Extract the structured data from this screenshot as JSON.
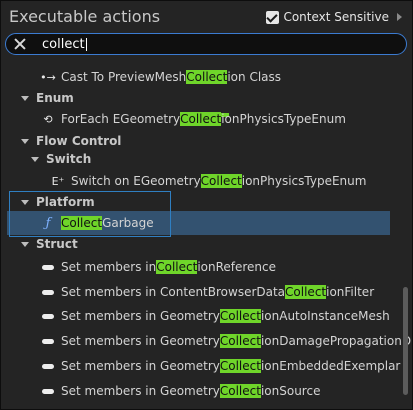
{
  "header": {
    "title": "Executable actions",
    "context_label": "Context Sensitive",
    "context_checked": true
  },
  "search": {
    "value": "collect"
  },
  "items": {
    "cast": {
      "pre": "Cast To PreviewMesh",
      "match": "Collect",
      "post": "ion Class"
    },
    "cat_enum": "Enum",
    "foreach": {
      "pre": "ForEach EGeometry",
      "match": "Collect",
      "post": "ionPhysicsTypeEnum"
    },
    "cat_flow": "Flow Control",
    "cat_switch": "Switch",
    "switch": {
      "pre": "Switch on EGeometry",
      "match": "Collect",
      "post": "ionPhysicsTypeEnum"
    },
    "cat_platform": "Platform",
    "collect_garbage": {
      "pre": "",
      "match": "Collect",
      "post": " Garbage"
    },
    "cat_struct": "Struct",
    "s1": {
      "pre": "Set members in ",
      "match": "Collect",
      "post": "ionReference"
    },
    "s2": {
      "pre": "Set members in ContentBrowserData",
      "match": "Collect",
      "post": "ionFilter"
    },
    "s3": {
      "pre": "Set members in Geometry",
      "match": "Collect",
      "post": "ionAutoInstanceMesh"
    },
    "s4": {
      "pre": "Set members in Geometry",
      "match": "Collect",
      "post": "ionDamagePropagationD"
    },
    "s5": {
      "pre": "Set members in Geometry",
      "match": "Collect",
      "post": "ionEmbeddedExemplar"
    },
    "s6": {
      "pre": "Set members in Geometry",
      "match": "Collect",
      "post": "ionSource"
    }
  },
  "colors": {
    "highlight": "#6fd52a",
    "selected": "#335270",
    "accent": "#3b7bd1"
  }
}
